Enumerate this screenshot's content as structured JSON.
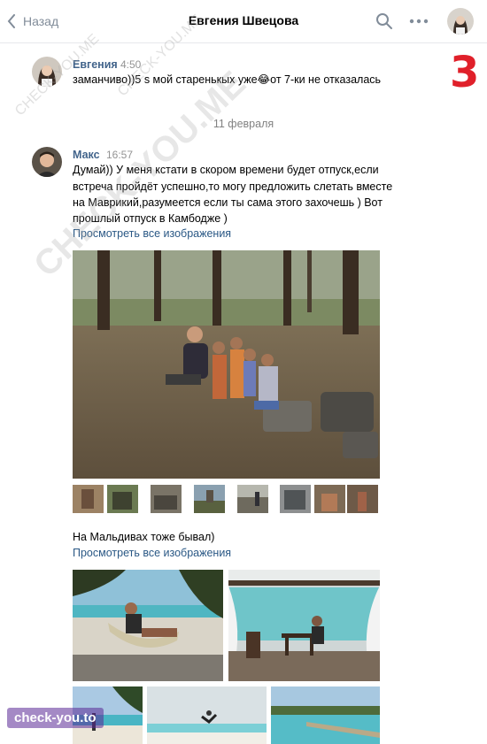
{
  "header": {
    "back_label": "Назад",
    "title": "Евгения Швецова",
    "back_icon": "chevron-left-icon",
    "search_icon": "search-icon",
    "more_icon": "more-icon"
  },
  "messages": [
    {
      "name": "Евгения",
      "time": "4:50",
      "text": "заманчиво))5 s мой старенькых уже😂от 7-ки не отказалась"
    },
    {
      "name": "Макс",
      "time": "16:57",
      "lines": [
        "Думай)) У меня кстати в скором времени будет отпуск,если",
        "встреча пройдёт успешно,то могу предложить слетать вместе",
        "на Маврикий,разумеется если ты сама этого захочешь ) Вот",
        "прошлый отпуск в Камбодже )"
      ],
      "view_all_label": "Просмотреть все изображения"
    },
    {
      "text": "На Мальдивах тоже бывал)",
      "view_all_label": "Просмотреть все изображения"
    }
  ],
  "date_separator": "11 февраля",
  "annotation_number": "3",
  "watermarks": {
    "diagonal": "CHECK-YOU.ME",
    "small_top": "CHECK-YOU.ME",
    "small_left": "CHECK-YOU.ME",
    "badge": "check-you.to"
  },
  "colors": {
    "link": "#2a5885",
    "name": "#42648b",
    "annotation": "#e0202a"
  }
}
